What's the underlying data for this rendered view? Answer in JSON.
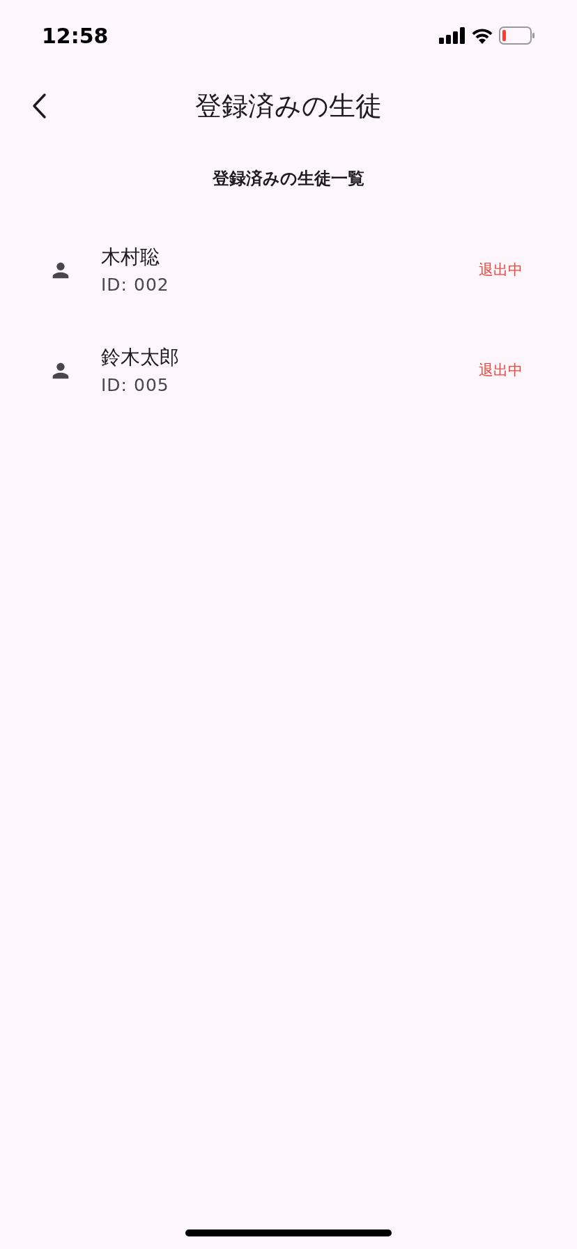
{
  "status_bar": {
    "time": "12:58"
  },
  "header": {
    "title": "登録済みの生徒"
  },
  "section_title": "登録済みの生徒一覧",
  "students": [
    {
      "name": "木村聡",
      "id": "ID: 002",
      "status": "退出中"
    },
    {
      "name": "鈴木太郎",
      "id": "ID: 005",
      "status": "退出中"
    }
  ]
}
